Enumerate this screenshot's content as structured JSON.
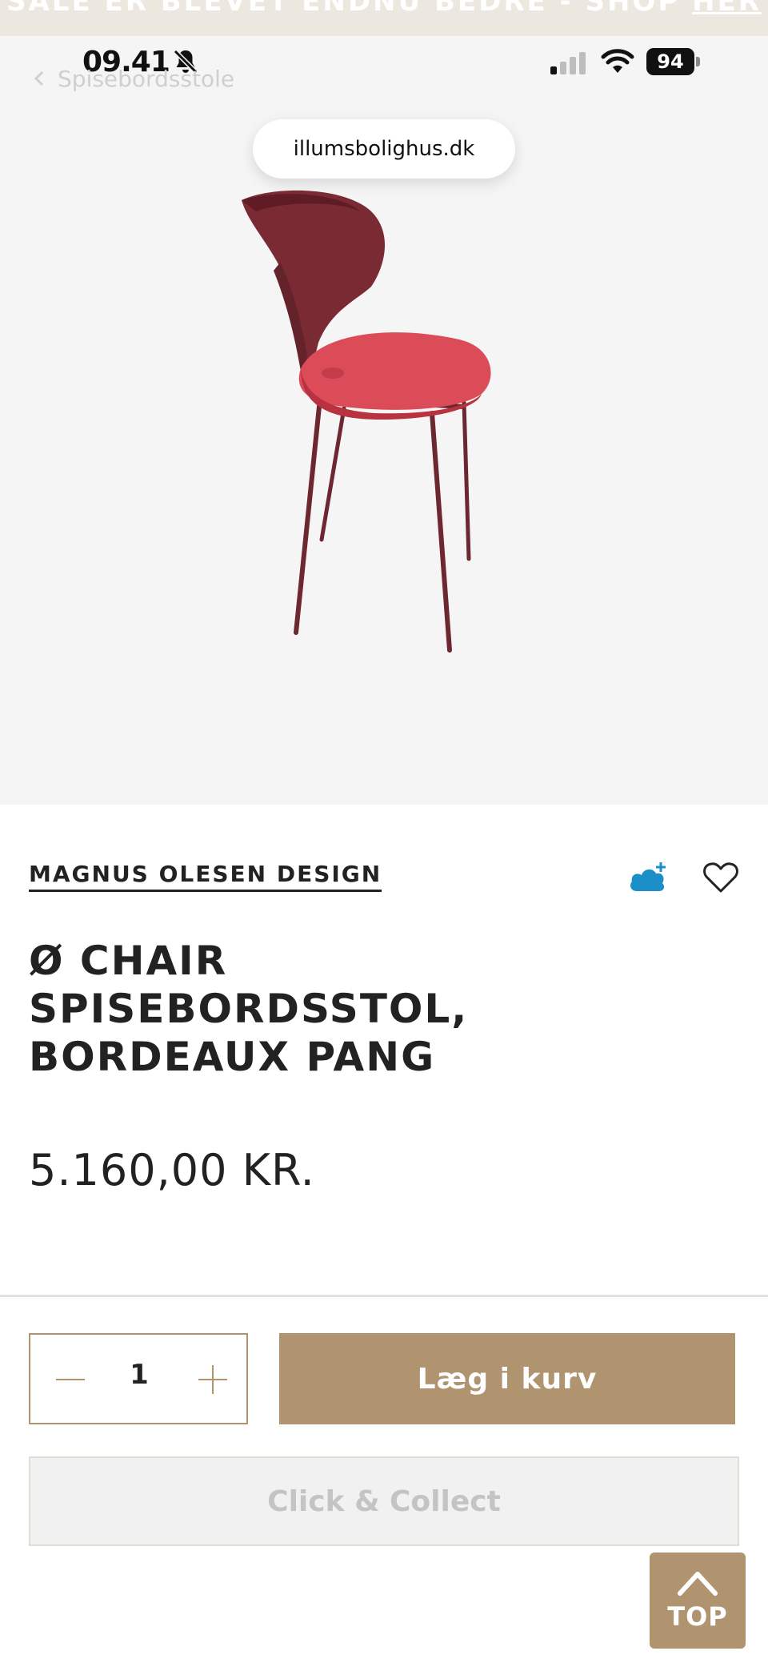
{
  "promo_banner": {
    "text": "SALE ER BLEVET ENDNU BEDRE - SHOP ",
    "link_label": "HER"
  },
  "status_bar": {
    "time": "09.41",
    "battery_level": "94",
    "icons": [
      "bell-off-icon",
      "signal-icon",
      "wifi-icon",
      "battery-icon"
    ]
  },
  "breadcrumb": {
    "label": "Spisebordsstole",
    "icon": "chevron-left-icon"
  },
  "browser": {
    "url": "illumsbolighus.dk"
  },
  "product": {
    "brand": "MAGNUS OLESEN DESIGN",
    "title_lines": [
      "Ø CHAIR",
      "SPISEBORDSSTOL,",
      "BORDEAUX PANG"
    ],
    "price": "5.160,00 KR.",
    "image_icon": "chair-image",
    "colors": {
      "shell": "#7a2a33",
      "seat": "#dc4c58",
      "legs": "#6d2730"
    }
  },
  "actions": {
    "quantity": "1",
    "add_to_cart_label": "Læg i kurv",
    "click_collect_label": "Click & Collect",
    "top_label": "TOP"
  },
  "colors": {
    "accent": "#b09470",
    "cloud_icon": "#1c8fc9",
    "text": "#222222"
  }
}
